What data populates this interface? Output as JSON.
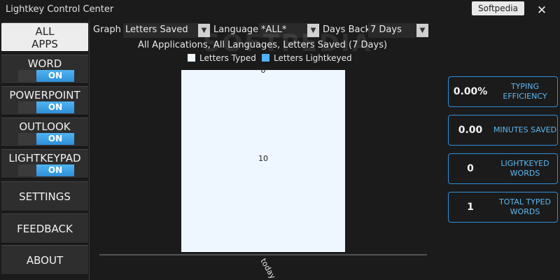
{
  "window": {
    "title": "Lightkey Control Center",
    "watermark_badge": "Softpedia",
    "close_glyph": "✕"
  },
  "sidebar": {
    "all_apps_label": "ALL\nAPPS",
    "apps": [
      {
        "label": "WORD",
        "toggle": "ON"
      },
      {
        "label": "POWERPOINT",
        "toggle": "ON"
      },
      {
        "label": "OUTLOOK",
        "toggle": "ON"
      },
      {
        "label": "LIGHTKEYPAD",
        "toggle": "ON"
      }
    ],
    "nav": [
      "SETTINGS",
      "FEEDBACK",
      "ABOUT"
    ]
  },
  "controls": {
    "graph_label": "Graph",
    "graph_value": "Letters Saved",
    "language_label": "Language",
    "language_value": "*ALL*",
    "days_label": "Days Back",
    "days_value": "7 Days"
  },
  "chart": {
    "title": "All Applications, All Languages, Letters Saved (7 Days)"
  },
  "chart_data": {
    "type": "bar",
    "title": "All Applications, All Languages, Letters Saved (7 Days)",
    "categories": [
      "today"
    ],
    "series": [
      {
        "name": "Letters Typed",
        "color": "#eef6ff",
        "values": [
          1
        ]
      },
      {
        "name": "Letters Lightkeyed",
        "color": "#4fb4f2",
        "values": [
          0
        ]
      }
    ],
    "value_labels": [
      "0",
      "10"
    ],
    "ylim": [
      0,
      1
    ],
    "grid": false,
    "legend": "top"
  },
  "watermark": "SOFTPEDIA",
  "stats": [
    {
      "value": "0.00%",
      "label": "TYPING EFFICIENCY"
    },
    {
      "value": "0.00",
      "label": "MINUTES SAVED"
    },
    {
      "value": "0",
      "label": "LIGHTKEYED WORDS"
    },
    {
      "value": "1",
      "label": "TOTAL TYPED WORDS"
    }
  ]
}
